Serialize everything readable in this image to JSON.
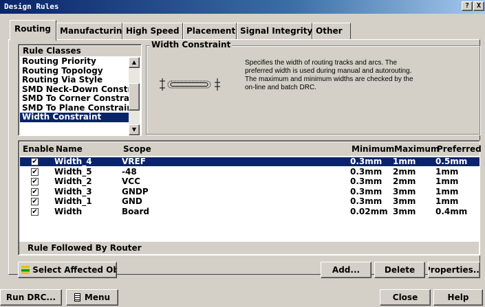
{
  "window": {
    "title": "Design Rules",
    "help_btn": "?",
    "close_btn": "X"
  },
  "tabs": [
    "Routing",
    "Manufacturing",
    "High Speed",
    "Placement",
    "Signal Integrity",
    "Other"
  ],
  "rule_classes": {
    "header": "Rule Classes",
    "items": [
      "Routing Priority",
      "Routing Topology",
      "Routing Via Style",
      "SMD Neck-Down Constra",
      "SMD To Corner Constrai",
      "SMD To Plane Constrain",
      "Width Constraint"
    ],
    "selected_index": 6
  },
  "width_constraint": {
    "title": "Width Constraint",
    "description": "Specifies the width of routing tracks and arcs. The preferred width is used during manual and autorouting. The maximum and minimum widths are checked by the on-line and batch DRC."
  },
  "table": {
    "headers": [
      "Enable",
      "Name",
      "Scope",
      "Minimum",
      "Maximum",
      "Preferred"
    ],
    "rows": [
      {
        "enabled": true,
        "name": "Width_4",
        "scope": "VREF",
        "min": "0.3mm",
        "max": "1mm",
        "pref": "0.5mm"
      },
      {
        "enabled": true,
        "name": "Width_5",
        "scope": "-48",
        "min": "0.3mm",
        "max": "2mm",
        "pref": "1mm"
      },
      {
        "enabled": true,
        "name": "Width_2",
        "scope": "VCC",
        "min": "0.3mm",
        "max": "2mm",
        "pref": "1mm"
      },
      {
        "enabled": true,
        "name": "Width_3",
        "scope": "GNDP",
        "min": "0.3mm",
        "max": "3mm",
        "pref": "1mm"
      },
      {
        "enabled": true,
        "name": "Width_1",
        "scope": "GND",
        "min": "0.3mm",
        "max": "3mm",
        "pref": "1mm"
      },
      {
        "enabled": true,
        "name": "Width",
        "scope": "Board",
        "min": "0.02mm",
        "max": "3mm",
        "pref": "0.4mm"
      }
    ],
    "selected_index": 0,
    "footer": "Rule Followed By Router"
  },
  "buttons": {
    "select_affected": "Select Affected Ob",
    "add": "Add...",
    "delete": "Delete",
    "properties": "Properties...",
    "run_drc": "Run DRC...",
    "menu": "Menu",
    "close": "Close",
    "help": "Help"
  },
  "checkmark": "✔"
}
